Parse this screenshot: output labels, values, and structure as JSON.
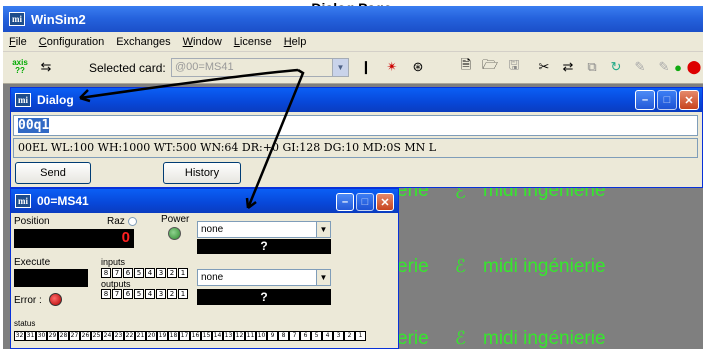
{
  "caption": "Dialog Page",
  "app": {
    "title": "WinSim2",
    "icon_text": "mi"
  },
  "menu": [
    {
      "label": "File",
      "key": "F",
      "rest": "ile"
    },
    {
      "label": "Configuration",
      "key": "C",
      "rest": "onfiguration"
    },
    {
      "label": "Exchanges",
      "key": "",
      "rest": "Exchanges"
    },
    {
      "label": "Window",
      "key": "W",
      "rest": "indow"
    },
    {
      "label": "License",
      "key": "L",
      "rest": "icense"
    },
    {
      "label": "Help",
      "key": "H",
      "rest": "elp"
    }
  ],
  "toolbar": {
    "selected_card_label": "Selected card:",
    "selected_card_value": "@00=MS41",
    "axis_btn": "axis ??"
  },
  "dialog": {
    "title": "Dialog",
    "input_value": "00q1",
    "output_line": "00EL WL:100 WH:1000 WT:500 WN:64 DR:+0 GI:128 DG:10 MD:0S MN L",
    "send_label": "Send",
    "history_label": "History"
  },
  "ms41": {
    "title": "00=MS41",
    "position_label": "Position",
    "raz_label": "Raz",
    "power_label": "Power",
    "position_value": "0",
    "execute_label": "Execute",
    "inputs_label": "inputs",
    "outputs_label": "outputs",
    "error_label": "Error :",
    "status_label": "status",
    "combo1_value": "none",
    "combo2_value": "none",
    "q1": "?",
    "q2": "?",
    "input_bits": [
      "8",
      "7",
      "6",
      "5",
      "4",
      "3",
      "2",
      "1"
    ],
    "output_bits": [
      "8",
      "7",
      "6",
      "5",
      "4",
      "3",
      "2",
      "1"
    ],
    "status_bits": [
      "32",
      "31",
      "30",
      "29",
      "28",
      "27",
      "26",
      "25",
      "24",
      "23",
      "22",
      "21",
      "20",
      "19",
      "18",
      "17",
      "16",
      "15",
      "14",
      "13",
      "12",
      "11",
      "10",
      "9",
      "8",
      "7",
      "6",
      "5",
      "4",
      "3",
      "2",
      "1"
    ]
  },
  "background": {
    "watermark": "midi ingénierie",
    "watermark_short": "erie",
    "accent_color": "#35e82c"
  }
}
